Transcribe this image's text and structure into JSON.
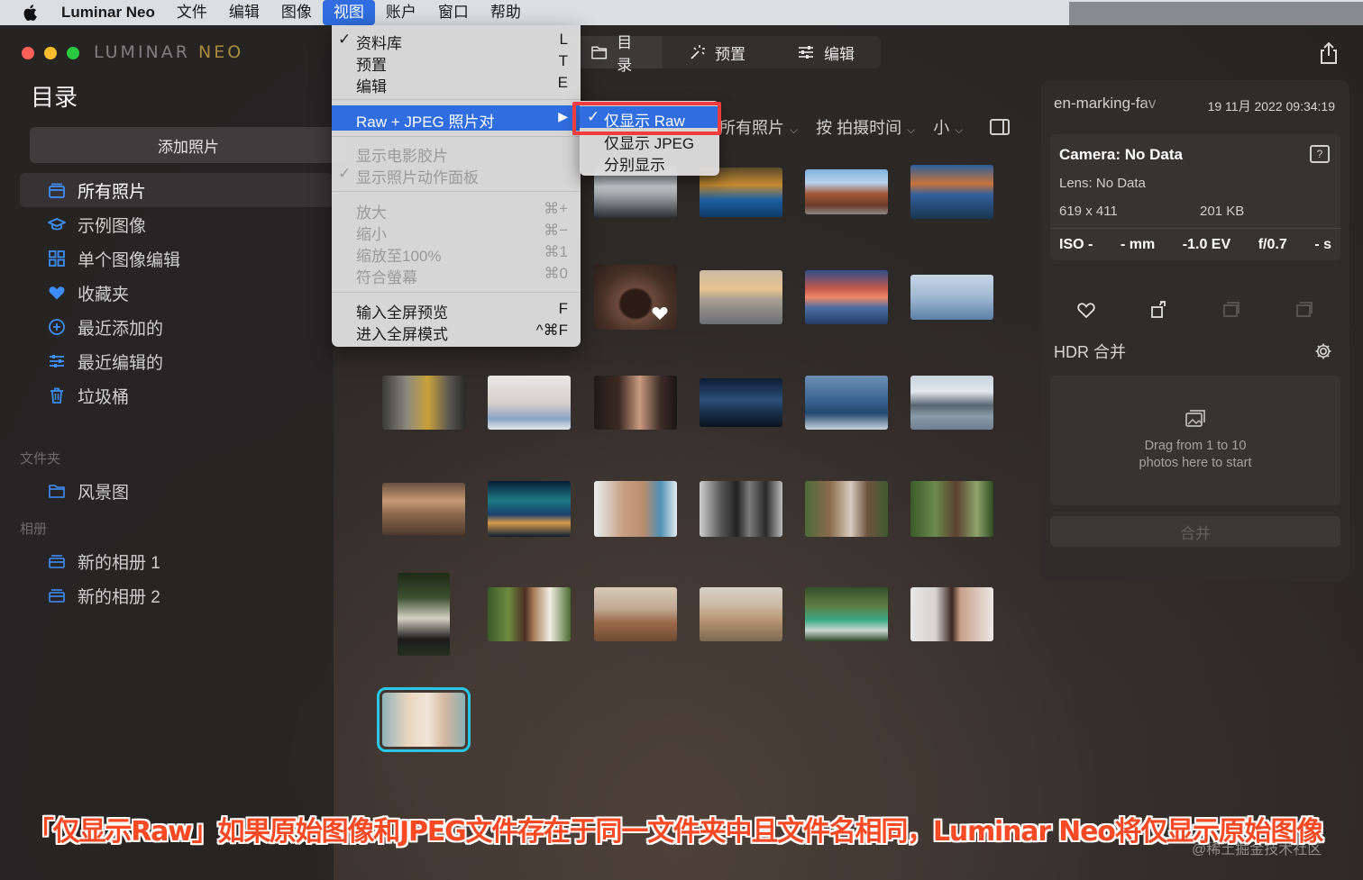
{
  "menubar": {
    "app_name": "Luminar Neo",
    "items": [
      "文件",
      "编辑",
      "图像",
      "视图",
      "账户",
      "窗口",
      "帮助"
    ],
    "active_item": "视图"
  },
  "sidebar": {
    "logo_main": "LUMINAR ",
    "logo_accent": "NEO",
    "title": "目录",
    "add_button": "添加照片",
    "items": [
      {
        "label": "所有照片",
        "icon": "photos-icon"
      },
      {
        "label": "示例图像",
        "icon": "graduation-cap-icon"
      },
      {
        "label": "单个图像编辑",
        "icon": "grid-icon"
      },
      {
        "label": "收藏夹",
        "icon": "heart-icon"
      },
      {
        "label": "最近添加的",
        "icon": "plus-circle-icon"
      },
      {
        "label": "最近编辑的",
        "icon": "sliders-icon"
      },
      {
        "label": "垃圾桶",
        "icon": "trash-icon"
      }
    ],
    "folders_label": "文件夹",
    "folders": [
      {
        "label": "风景图",
        "icon": "folder-icon"
      }
    ],
    "albums_label": "相册",
    "albums": [
      {
        "label": "新的相册 1",
        "icon": "album-icon"
      },
      {
        "label": "新的相册 2",
        "icon": "album-icon"
      }
    ]
  },
  "toolbar": {
    "tabs": [
      {
        "label": "目录",
        "icon": "folder-icon"
      },
      {
        "label": "预置",
        "icon": "sparkle-icon"
      },
      {
        "label": "编辑",
        "icon": "sliders-icon"
      }
    ]
  },
  "filters": {
    "show": "所有照片",
    "sort": "按 拍摄时间",
    "size": "小"
  },
  "view_menu": {
    "items": [
      {
        "label": "资料库",
        "key": "L",
        "checked": true
      },
      {
        "label": "预置",
        "key": "T"
      },
      {
        "label": "编辑",
        "key": "E"
      },
      {
        "label": "Raw + JPEG 照片对",
        "key": "▶"
      },
      {
        "label": "显示电影胶片",
        "key": ""
      },
      {
        "label": "显示照片动作面板",
        "key": "",
        "checked": true
      },
      {
        "label": "放大",
        "key": "⌘+"
      },
      {
        "label": "缩小",
        "key": "⌘−"
      },
      {
        "label": "缩放至100%",
        "key": "⌘1"
      },
      {
        "label": "符合螢幕",
        "key": "⌘0"
      },
      {
        "label": "输入全屏预览",
        "key": "F"
      },
      {
        "label": "进入全屏模式",
        "key": "^⌘F"
      }
    ],
    "checkmark": "✓"
  },
  "raw_submenu": {
    "items": [
      "仅显示 Raw",
      "仅显示 JPEG",
      "分别显示"
    ],
    "checked": "仅显示 Raw"
  },
  "info_panel": {
    "filename": "en-marking-fav",
    "date": "19 11月 2022 09:34:19",
    "camera": "Camera: No Data",
    "lens": "Lens: No Data",
    "dimensions": "619 x 411",
    "filesize": "201 KB",
    "exif": [
      "ISO -",
      "- mm",
      "-1.0 EV",
      "f/0.7",
      "- s"
    ]
  },
  "hdr_panel": {
    "title": "HDR 合并",
    "drop_line1": "Drag from 1 to 10",
    "drop_line2": "photos here to start",
    "merge_button": "合并"
  },
  "caption": "「仅显示Raw」如果原始图像和JPEG文件存在于同一文件夹中且文件名相同，Luminar Neo将仅显示原始图像",
  "watermark": "@稀土掘金技术社区",
  "colors": {
    "accent_blue": "#2f6de0",
    "highlight_red": "#f03c3c",
    "selection_cyan": "#29c6e8",
    "sidebar_icon_blue": "#3e8ef7",
    "caption_orange": "#f74a24"
  }
}
